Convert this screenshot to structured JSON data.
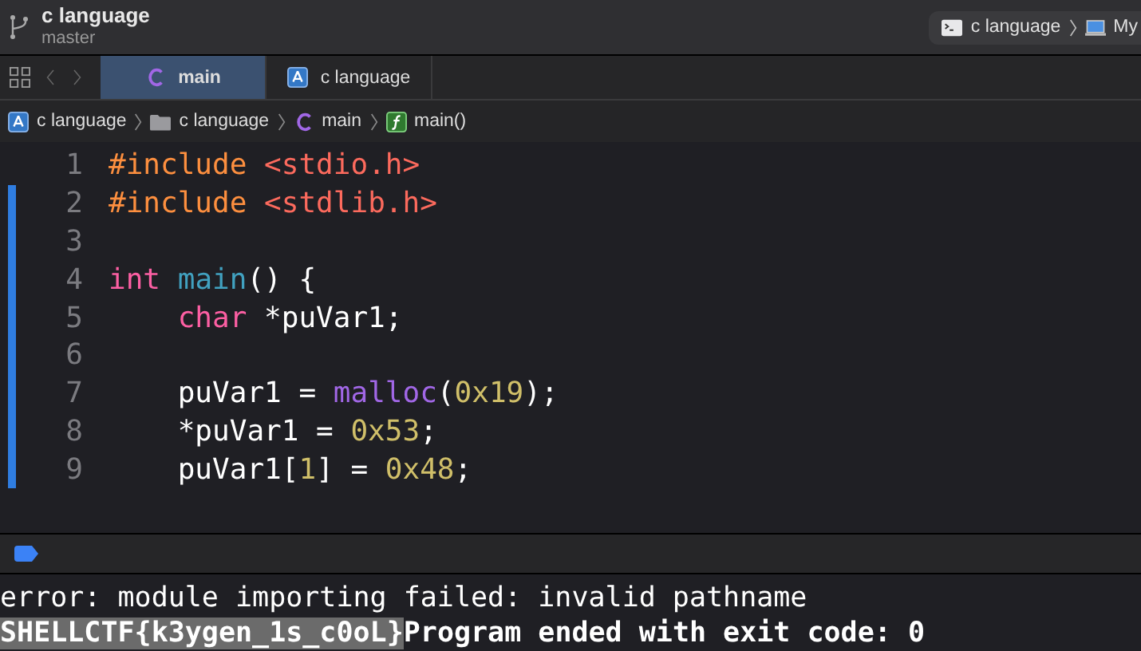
{
  "toolbar": {
    "project": "c language",
    "branch": "master",
    "scheme": {
      "target": "c language",
      "destination": "My"
    }
  },
  "tabs": [
    {
      "label": "main",
      "kind": "c-file",
      "selected": true
    },
    {
      "label": "c language",
      "kind": "project",
      "selected": false
    }
  ],
  "breadcrumb": [
    {
      "label": "c language",
      "kind": "project"
    },
    {
      "label": "c language",
      "kind": "folder"
    },
    {
      "label": "main",
      "kind": "c-file"
    },
    {
      "label": "main()",
      "kind": "function"
    }
  ],
  "editor": {
    "lines": [
      {
        "number": "1",
        "changed": false,
        "tokens": [
          {
            "text": "#include ",
            "kind": "preproc"
          },
          {
            "text": "<stdio.h>",
            "kind": "string"
          }
        ]
      },
      {
        "number": "2",
        "changed": true,
        "tokens": [
          {
            "text": "#include ",
            "kind": "preproc"
          },
          {
            "text": "<stdlib.h>",
            "kind": "string"
          }
        ]
      },
      {
        "number": "3",
        "changed": true
      },
      {
        "number": "4",
        "changed": true,
        "tokens": [
          {
            "text": "int",
            "kind": "keyword"
          },
          {
            "text": " main",
            "kind": "declaration"
          },
          {
            "text": "() {",
            "kind": "plain"
          }
        ]
      },
      {
        "number": "5",
        "changed": true,
        "tokens": [
          {
            "text": "    char",
            "kind": "keyword"
          },
          {
            "text": " *puVar1;",
            "kind": "plain"
          }
        ]
      },
      {
        "number": "6",
        "changed": true
      },
      {
        "number": "7",
        "changed": true,
        "tokens": [
          {
            "text": "    puVar1 = ",
            "kind": "plain"
          },
          {
            "text": "malloc",
            "kind": "call"
          },
          {
            "text": "(",
            "kind": "plain"
          },
          {
            "text": "0x19",
            "kind": "number"
          },
          {
            "text": ");",
            "kind": "plain"
          }
        ]
      },
      {
        "number": "8",
        "changed": true,
        "tokens": [
          {
            "text": "    *puVar1 = ",
            "kind": "plain"
          },
          {
            "text": "0x53",
            "kind": "number"
          },
          {
            "text": ";",
            "kind": "plain"
          }
        ]
      },
      {
        "number": "9",
        "changed": true,
        "tokens": [
          {
            "text": "    puVar1[",
            "kind": "plain"
          },
          {
            "text": "1",
            "kind": "number"
          },
          {
            "text": "] = ",
            "kind": "plain"
          },
          {
            "text": "0x48",
            "kind": "number"
          },
          {
            "text": ";",
            "kind": "plain"
          }
        ]
      }
    ]
  },
  "console": {
    "lines": [
      {
        "kind": "error",
        "segments": [
          {
            "text": "error: module importing failed: invalid pathname",
            "selected": false
          }
        ]
      },
      {
        "kind": "program",
        "segments": [
          {
            "text": "SHELLCTF{k3ygen_1s_c0oL}",
            "selected": true
          },
          {
            "text": "Program ended with exit code: 0",
            "selected": false
          }
        ]
      }
    ]
  }
}
